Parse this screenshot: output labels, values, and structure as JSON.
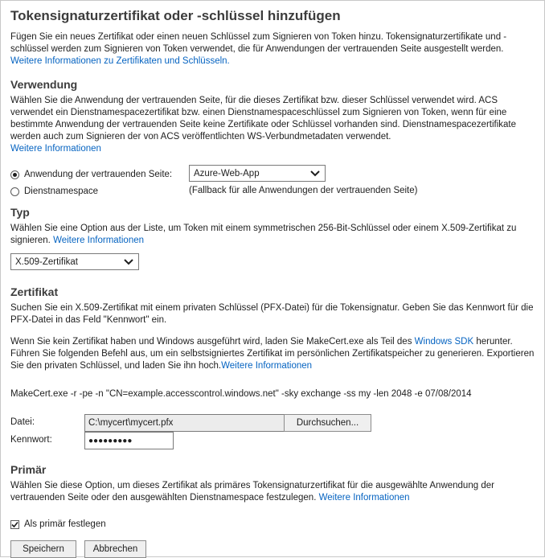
{
  "title": "Tokensignaturzertifikat oder -schlüssel hinzufügen",
  "intro": {
    "text": "Fügen Sie ein neues Zertifikat oder einen neuen Schlüssel zum Signieren von Token hinzu. Tokensignaturzertifikate und -schlüssel werden zum Signieren von Token verwendet, die für Anwendungen der vertrauenden Seite ausgestellt werden.",
    "link": "Weitere Informationen zu Zertifikaten und Schlüsseln."
  },
  "verwendung": {
    "heading": "Verwendung",
    "text": "Wählen Sie die Anwendung der vertrauenden Seite, für die dieses Zertifikat bzw. dieser Schlüssel verwendet wird. ACS verwendet ein Dienstnamespacezertifikat bzw. einen Dienstnamespaceschlüssel zum Signieren von Token, wenn für eine bestimmte Anwendung der vertrauenden Seite keine Zertifikate oder Schlüssel vorhanden sind.  Dienstnamespacezertifikate werden auch zum Signieren der von ACS veröffentlichten WS-Verbundmetadaten verwendet.",
    "link": "Weitere Informationen",
    "radio_rp_label": "Anwendung der vertrauenden Seite:",
    "radio_rp_checked": true,
    "rp_select_value": "Azure-Web-App",
    "radio_ns_label": "Dienstnamespace",
    "radio_ns_checked": false,
    "ns_note": "(Fallback für alle Anwendungen der vertrauenden Seite)"
  },
  "typ": {
    "heading": "Typ",
    "text": "Wählen Sie eine Option aus der Liste, um Token mit einem symmetrischen 256-Bit-Schlüssel oder einem X.509-Zertifikat zu signieren.",
    "link": "Weitere Informationen",
    "select_value": "X.509-Zertifikat"
  },
  "zertifikat": {
    "heading": "Zertifikat",
    "text1": "Suchen Sie ein X.509-Zertifikat mit einem privaten Schlüssel (PFX-Datei) für die Tokensignatur. Geben Sie das Kennwort für die PFX-Datei in das Feld \"Kennwort\" ein.",
    "text2_before": "Wenn Sie kein Zertifikat haben und Windows ausgeführt wird, laden Sie MakeCert.exe als Teil des",
    "sdk_link": "Windows SDK",
    "text2_after": "herunter. Führen Sie folgenden Befehl aus, um ein selbstsigniertes Zertifikat im persönlichen Zertifikatspeicher zu generieren. Exportieren Sie den privaten Schlüssel, und laden Sie ihn hoch.",
    "link": "Weitere Informationen",
    "command": "MakeCert.exe -r -pe -n \"CN=example.accesscontrol.windows.net\" -sky exchange -ss my -len 2048 -e 07/08/2014",
    "file_label": "Datei:",
    "file_value": "C:\\mycert\\mycert.pfx",
    "browse_label": "Durchsuchen...",
    "password_label": "Kennwort:",
    "password_value": "●●●●●●●●●"
  },
  "primaer": {
    "heading": "Primär",
    "text": "Wählen Sie diese Option, um dieses Zertifikat als primäres Tokensignaturzertifikat für die ausgewählte Anwendung der vertrauenden Seite oder den ausgewählten Dienstnamespace festzulegen.",
    "link": "Weitere Informationen",
    "checkbox_label": "Als primär festlegen",
    "checkbox_checked": true
  },
  "buttons": {
    "save": "Speichern",
    "cancel": "Abbrechen"
  }
}
